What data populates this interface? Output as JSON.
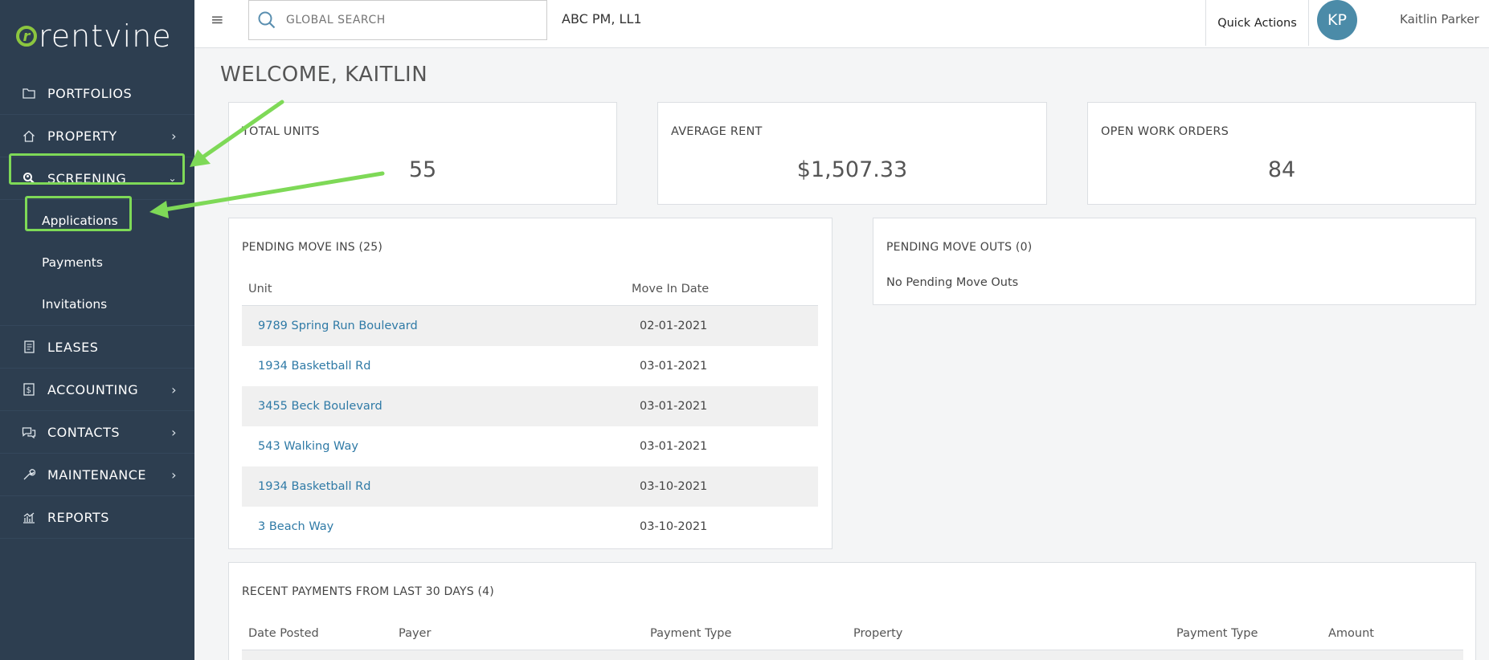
{
  "brand": {
    "logo_text": "rentvine",
    "accent": "#8cc63f",
    "sidebar_bg": "#2d3e50",
    "highlight": "#7ed957"
  },
  "sidebar": {
    "items": [
      {
        "label": "PORTFOLIOS",
        "icon": "folder-icon"
      },
      {
        "label": "PROPERTY",
        "icon": "home-icon"
      },
      {
        "label": "SCREENING",
        "icon": "search-user-icon"
      },
      {
        "label": "LEASES",
        "icon": "document-icon"
      },
      {
        "label": "ACCOUNTING",
        "icon": "dollar-icon"
      },
      {
        "label": "CONTACTS",
        "icon": "chat-icon"
      },
      {
        "label": "MAINTENANCE",
        "icon": "wrench-icon"
      },
      {
        "label": "REPORTS",
        "icon": "chart-icon"
      }
    ],
    "screening_sub": [
      {
        "label": "Applications"
      },
      {
        "label": "Payments"
      },
      {
        "label": "Invitations"
      }
    ]
  },
  "topbar": {
    "search_placeholder": "GLOBAL SEARCH",
    "company": "ABC PM, LL1",
    "quick_actions": "Quick Actions",
    "avatar_initials": "KP",
    "user_name": "Kaitlin Parker"
  },
  "main": {
    "welcome": "WELCOME, KAITLIN",
    "stats": [
      {
        "label": "TOTAL UNITS",
        "value": "55"
      },
      {
        "label": "AVERAGE RENT",
        "value": "$1,507.33"
      },
      {
        "label": "OPEN WORK ORDERS",
        "value": "84"
      }
    ],
    "move_ins": {
      "title": "PENDING MOVE INS (25)",
      "col_unit": "Unit",
      "col_date": "Move In Date",
      "rows": [
        {
          "unit": "9789 Spring Run Boulevard",
          "date": "02-01-2021"
        },
        {
          "unit": "1934 Basketball Rd",
          "date": "03-01-2021"
        },
        {
          "unit": "3455 Beck Boulevard",
          "date": "03-01-2021"
        },
        {
          "unit": "543 Walking Way",
          "date": "03-01-2021"
        },
        {
          "unit": "1934 Basketball Rd",
          "date": "03-10-2021"
        },
        {
          "unit": "3 Beach Way",
          "date": "03-10-2021"
        }
      ]
    },
    "move_outs": {
      "title": "PENDING MOVE OUTS (0)",
      "empty": "No Pending Move Outs"
    },
    "payments": {
      "title": "RECENT PAYMENTS FROM LAST 30 DAYS (4)",
      "columns": [
        "Date Posted",
        "Payer",
        "Payment Type",
        "Property",
        "Payment Type",
        "Amount"
      ]
    }
  }
}
